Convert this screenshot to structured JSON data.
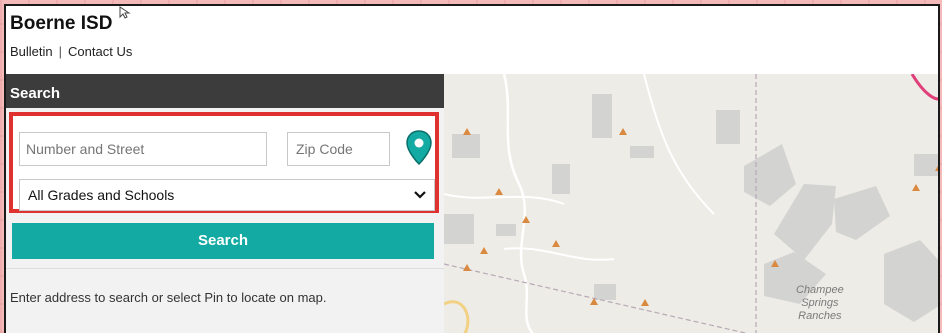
{
  "header": {
    "brand": "Boerne ISD",
    "nav": [
      {
        "label": "Bulletin"
      },
      {
        "label": "Contact Us"
      }
    ],
    "separator": "|"
  },
  "sidebar": {
    "title": "Search",
    "street_placeholder": "Number and Street",
    "zip_placeholder": "Zip Code",
    "grade_selected": "All Grades and Schools",
    "search_button": "Search",
    "help_text": "Enter address to search or select Pin to locate on map."
  },
  "map": {
    "place_label_line1": "Champee",
    "place_label_line2": "Springs",
    "place_label_line3": "Ranches"
  },
  "colors": {
    "accent": "#12aaa2",
    "highlight": "#e03131",
    "header_bar": "#3c3c3c"
  }
}
